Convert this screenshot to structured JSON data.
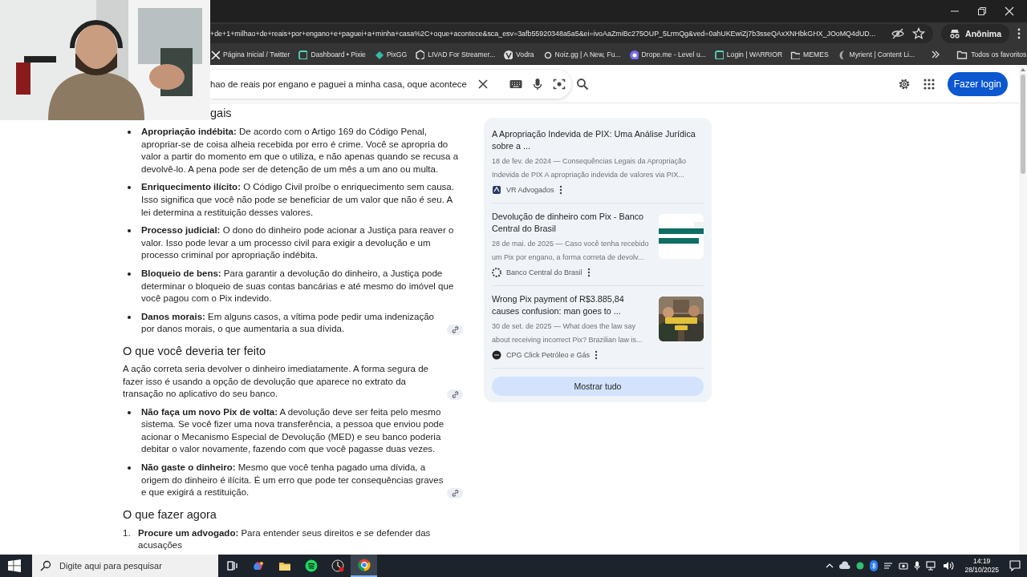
{
  "browser": {
    "url": "+de+1+milhao+de+reais+por+engano+e+paguei+a+minha+casa%2C+oque+acontece&sca_esv=3afb55920348a5a5&ei=ivoAaZmiBc275OUP_5LrmQg&ved=0ahUKEwiZj7b3sseQAxXNHbkGHX_JOoMQ4dUD...",
    "profile": "Anônima",
    "bookmarks": [
      {
        "label": "Página Inicial / Twitter",
        "kind": "x"
      },
      {
        "label": "Dashboard • Pixie",
        "kind": "square"
      },
      {
        "label": "PixGG",
        "kind": "diamond"
      },
      {
        "label": "LIVAD For Streamer...",
        "kind": "hex"
      },
      {
        "label": "Vodra",
        "kind": "vee"
      },
      {
        "label": "Noiz.gg | A New, Fu...",
        "kind": "dot"
      },
      {
        "label": "Drope.me - Level u...",
        "kind": "circle"
      },
      {
        "label": "Login | WARRIOR",
        "kind": "square"
      },
      {
        "label": "MEMES",
        "kind": "folder"
      },
      {
        "label": "Myrient | Content Li...",
        "kind": "crescent"
      }
    ],
    "all_bookmarks": "Todos os favoritos"
  },
  "header": {
    "search_value": "hao de reais por engano e paguei a minha casa, oque acontece",
    "login_button": "Fazer login"
  },
  "article": [
    {
      "kind": "heading",
      "text": "gais"
    },
    {
      "kind": "bullets",
      "items": [
        {
          "term": "Apropriação indébita:",
          "text": "De acordo com o Artigo 169 do Código Penal, apropriar-se de coisa alheia recebida por erro é crime. Você se apropria do valor a partir do momento em que o utiliza, e não apenas quando se recusa a devolvê-lo. A pena pode ser de detenção de um mês a um ano ou multa.",
          "source_link": false
        },
        {
          "term": "Enriquecimento ilícito:",
          "text": "O Código Civil proíbe o enriquecimento sem causa. Isso significa que você não pode se beneficiar de um valor que não é seu. A lei determina a restituição desses valores.",
          "source_link": false
        },
        {
          "term": "Processo judicial:",
          "text": "O dono do dinheiro pode acionar a Justiça para reaver o valor. Isso pode levar a um processo civil para exigir a devolução e um processo criminal por apropriação indébita.",
          "source_link": false
        },
        {
          "term": "Bloqueio de bens:",
          "text": "Para garantir a devolução do dinheiro, a Justiça pode determinar o bloqueio de suas contas bancárias e até mesmo do imóvel que você pagou com o Pix indevido.",
          "source_link": false
        },
        {
          "term": "Danos morais:",
          "text": "Em alguns casos, a vítima pode pedir uma indenização por danos morais, o que aumentaria a sua dívida.",
          "source_link": true
        }
      ]
    },
    {
      "kind": "heading",
      "text": "O que você deveria ter feito"
    },
    {
      "kind": "paragraph",
      "text": "A ação correta seria devolver o dinheiro imediatamente. A forma segura de fazer isso é usando a opção de devolução que aparece no extrato da transação no aplicativo do seu banco.",
      "source_link": true
    },
    {
      "kind": "bullets",
      "items": [
        {
          "term": "Não faça um novo Pix de volta:",
          "text": "A devolução deve ser feita pelo mesmo sistema. Se você fizer uma nova transferência, a pessoa que enviou pode acionar o Mecanismo Especial de Devolução (MED) e seu banco poderia debitar o valor novamente, fazendo com que você pagasse duas vezes.",
          "source_link": false
        },
        {
          "term": "Não gaste o dinheiro:",
          "text": "Mesmo que você tenha pagado uma dívida, a origem do dinheiro é ilícita. É um erro que pode ter consequências graves e que exigirá a restituição.",
          "source_link": true
        }
      ]
    },
    {
      "kind": "heading",
      "text": "O que fazer agora"
    },
    {
      "kind": "ordered",
      "items": [
        {
          "number": "1.",
          "term": "Procure um advogado:",
          "text": "Para entender seus direitos e se defender das acusações"
        }
      ]
    }
  ],
  "sources": {
    "items": [
      {
        "title": "A Apropriação Indevida de PIX: Uma Análise Jurídica sobre a ...",
        "snippet": "18 de fev. de 2024 — Consequências Legais da Apropriação Indevida de PIX A apropriação indevida de valores via PIX...",
        "source": "VR Advogados",
        "thumbnail": false
      },
      {
        "title": "Devolução de dinheiro com Pix - Banco Central do Brasil",
        "snippet": "28 de mai. de 2025 — Caso você tenha recebido um Pix por engano, a forma correta de devolv...",
        "source": "Banco Central do Brasil",
        "thumbnail": true
      },
      {
        "title": "Wrong Pix payment of R$3.885,84 causes confusion: man goes to ...",
        "snippet": "30 de set. de 2025 — What does the law say about receiving incorrect Pix? Brazilian law is...",
        "source": "CPG Click Petróleo e Gás",
        "thumbnail": true
      }
    ],
    "show_all": "Mostrar tudo"
  },
  "taskbar": {
    "search_placeholder": "Digite aqui para pesquisar",
    "apps": [
      {
        "kind": "taskview",
        "selected": false
      },
      {
        "kind": "copilot",
        "selected": false
      },
      {
        "kind": "explorer",
        "selected": false
      },
      {
        "kind": "music",
        "selected": false
      },
      {
        "kind": "recorder",
        "selected": false
      },
      {
        "kind": "browser",
        "selected": true
      }
    ],
    "time": "14:19",
    "date": "28/10/2025"
  }
}
